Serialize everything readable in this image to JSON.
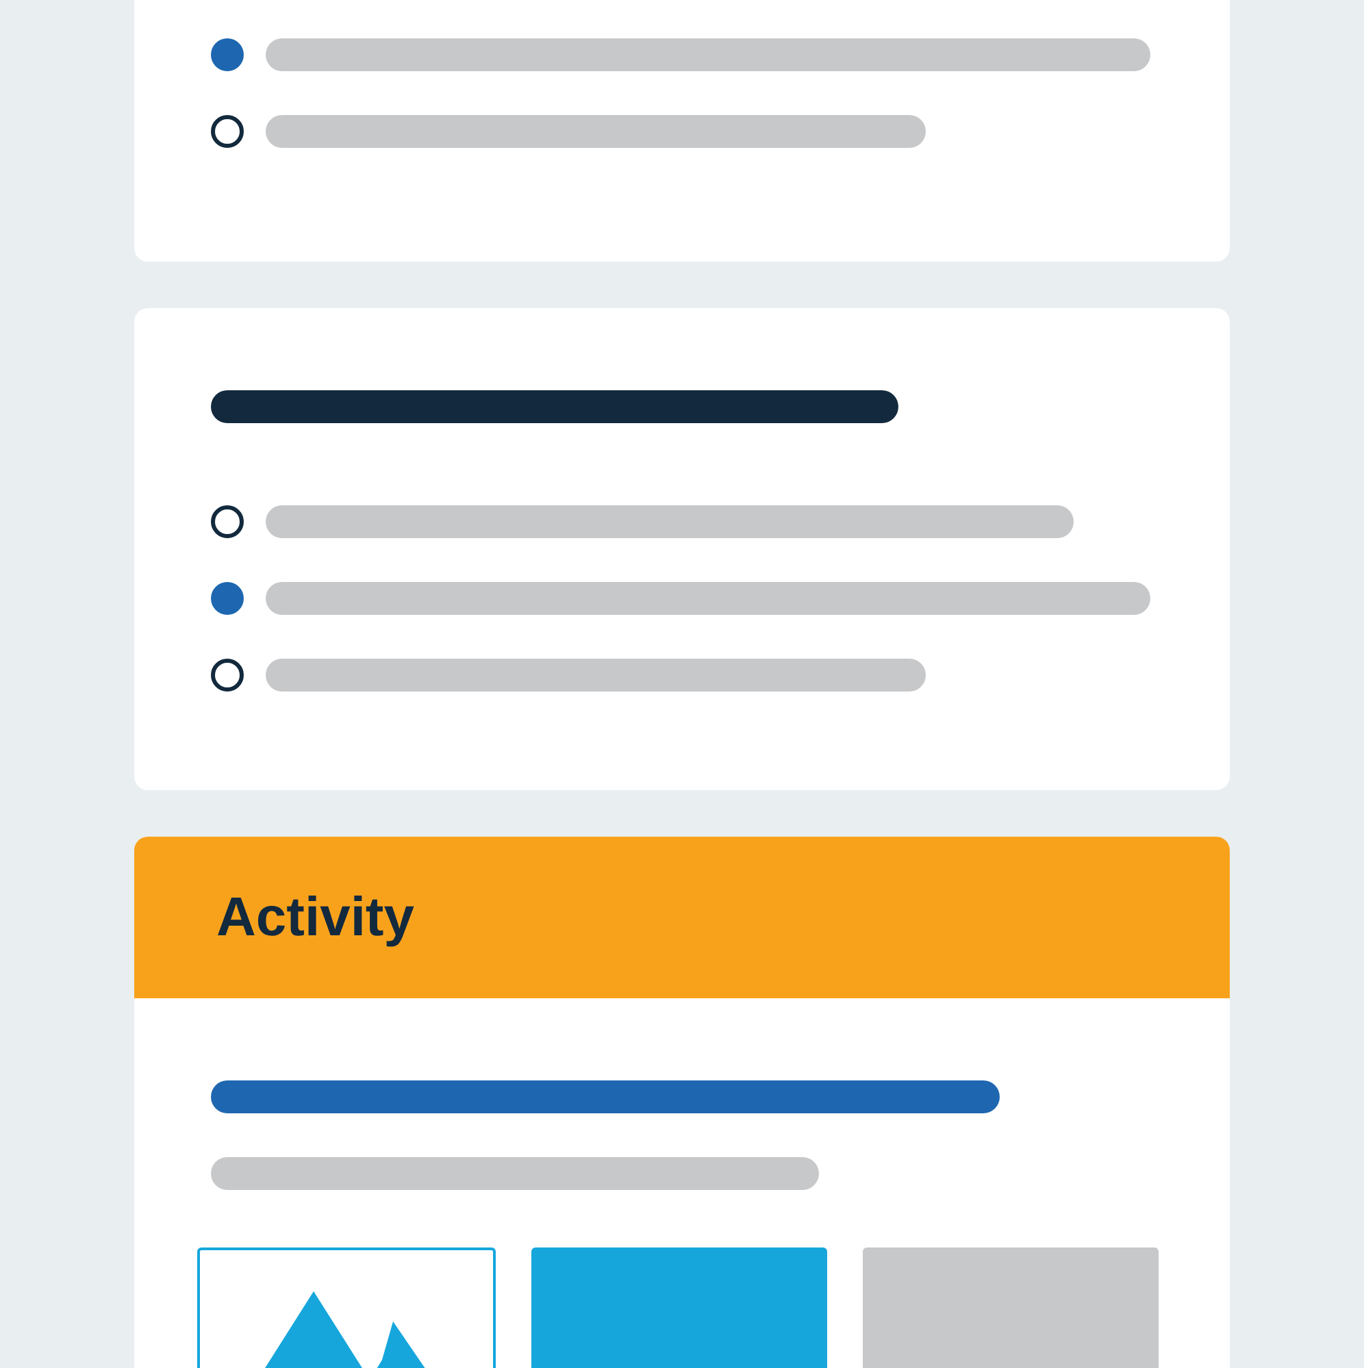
{
  "cards": [
    {
      "kind": "options",
      "options": [
        {
          "selected": true
        },
        {
          "selected": false
        }
      ]
    },
    {
      "kind": "question",
      "options": [
        {
          "selected": false
        },
        {
          "selected": true
        },
        {
          "selected": false
        }
      ]
    },
    {
      "kind": "activity",
      "title": "Activity",
      "tiles": [
        {
          "kind": "image"
        },
        {
          "kind": "blue"
        },
        {
          "kind": "gray"
        }
      ]
    }
  ]
}
